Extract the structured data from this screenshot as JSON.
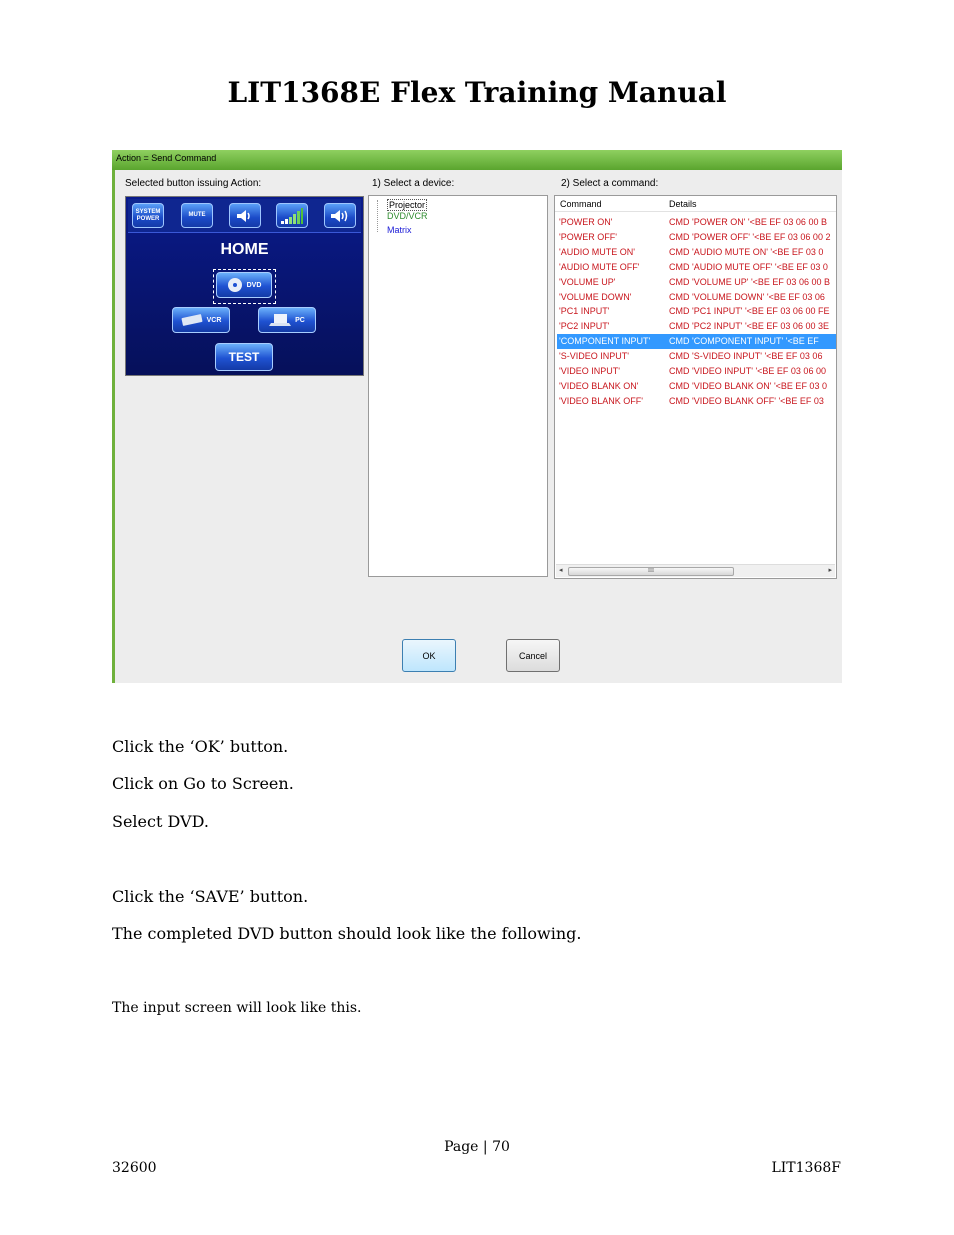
{
  "page_title": "LIT1368E Flex Training Manual",
  "dialog": {
    "title": "Action = Send Command",
    "label_selected": "Selected button issuing Action:",
    "label_device": "1) Select a device:",
    "label_command": "2) Select a command:",
    "preview": {
      "top_buttons": [
        "SYSTEM POWER",
        "MUTE"
      ],
      "home_label": "HOME",
      "dvd_label": "DVD",
      "vcr_label": "VCR",
      "pc_label": "PC",
      "test_label": "TEST"
    },
    "devices": [
      "Projector",
      "DVD/VCR",
      "Matrix"
    ],
    "device_colors": [
      "#000000",
      "#2e8b2e",
      "#1a1ad6"
    ],
    "grid_headers": [
      "Command",
      "Details"
    ],
    "commands": [
      {
        "command": "'POWER ON'",
        "details": "CMD 'POWER ON' '<BE EF 03 06 00 B"
      },
      {
        "command": "'POWER OFF'",
        "details": "CMD 'POWER OFF' '<BE EF 03 06 00 2"
      },
      {
        "command": "'AUDIO MUTE ON'",
        "details": "CMD 'AUDIO MUTE ON' '<BE EF 03 0"
      },
      {
        "command": "'AUDIO MUTE OFF'",
        "details": "CMD 'AUDIO MUTE OFF' '<BE EF 03 0"
      },
      {
        "command": "'VOLUME UP'",
        "details": "CMD 'VOLUME UP' '<BE EF 03 06 00 B"
      },
      {
        "command": "'VOLUME DOWN'",
        "details": "CMD 'VOLUME DOWN' '<BE EF 03 06"
      },
      {
        "command": "'PC1 INPUT'",
        "details": "CMD 'PC1 INPUT' '<BE EF 03 06 00 FE"
      },
      {
        "command": "'PC2 INPUT'",
        "details": "CMD 'PC2 INPUT' '<BE EF 03 06 00 3E"
      },
      {
        "command": "'COMPONENT INPUT'",
        "details": "CMD 'COMPONENT INPUT' '<BE EF"
      },
      {
        "command": "'S-VIDEO INPUT'",
        "details": "CMD 'S-VIDEO INPUT' '<BE EF 03 06"
      },
      {
        "command": "'VIDEO INPUT'",
        "details": "CMD 'VIDEO INPUT' '<BE EF 03 06 00"
      },
      {
        "command": "'VIDEO BLANK ON'",
        "details": "CMD 'VIDEO BLANK ON' '<BE EF 03 0"
      },
      {
        "command": "'VIDEO BLANK OFF'",
        "details": "CMD 'VIDEO BLANK OFF' '<BE EF 03"
      }
    ],
    "selected_command_index": 8,
    "scroll_thumb_label": "III",
    "ok_label": "OK",
    "cancel_label": "Cancel"
  },
  "paragraphs": [
    "Click the ‘OK’ button.",
    "Click on Go to Screen.",
    "Select DVD.",
    "Click the ‘SAVE’ button.",
    "The completed DVD button should look like the following.",
    "The input screen will look like this."
  ],
  "footer": {
    "page_label": "Page | 70",
    "left_code": "32600",
    "right_code": "LIT1368F"
  },
  "colors": {
    "dialog_frame": "#6fb13c",
    "command_text": "#c8161d",
    "selection": "#3399ff"
  }
}
